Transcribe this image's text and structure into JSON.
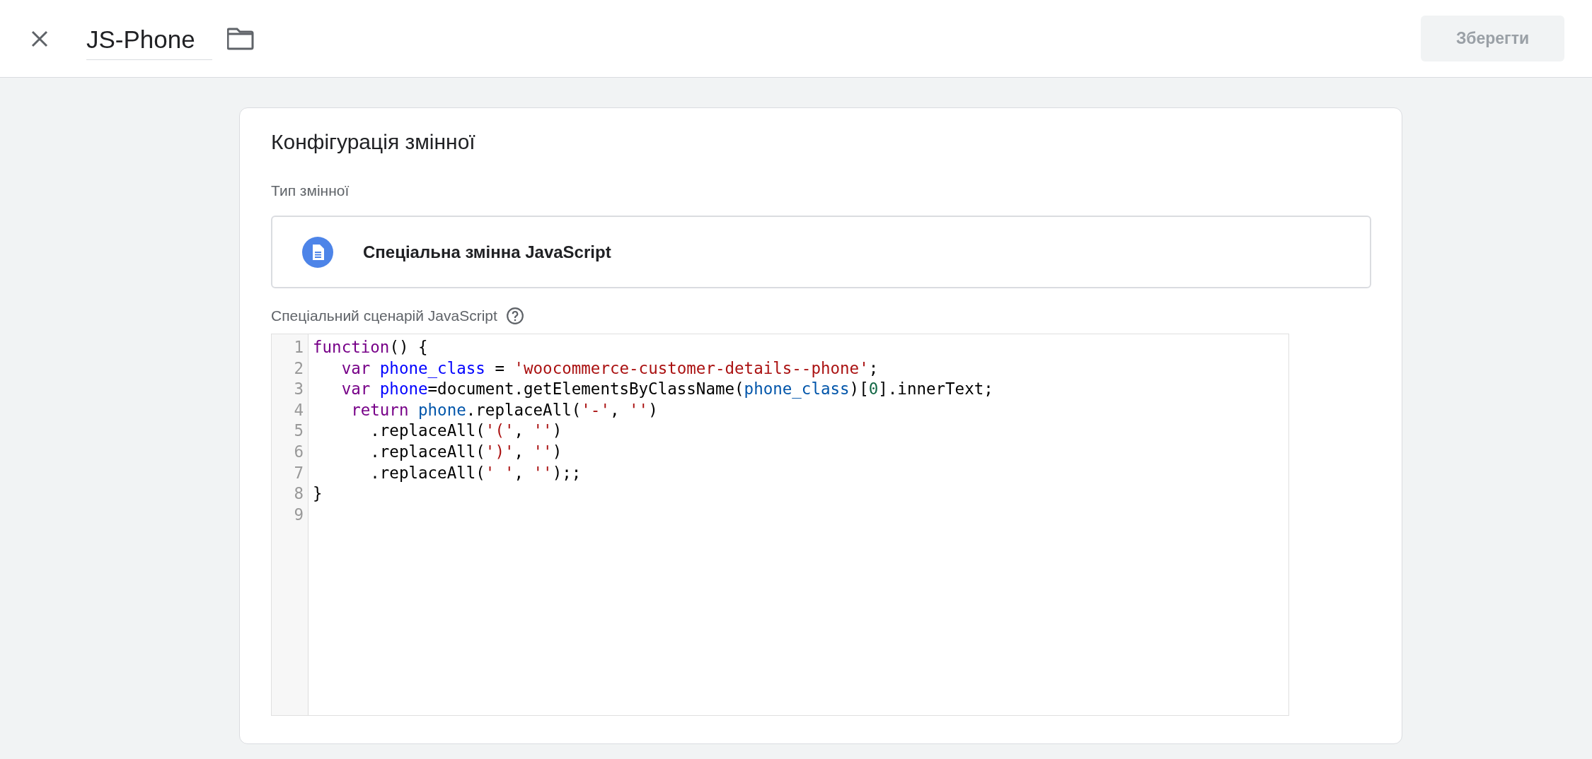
{
  "header": {
    "name": "JS-Phone",
    "save_button": {
      "label": "Зберегти",
      "disabled": true
    }
  },
  "card": {
    "title": "Конфігурація змінної",
    "type_label": "Тип змінної",
    "type_value": "Спеціальна змінна JavaScript",
    "script_label": "Спеціальний сценарій JavaScript",
    "code_lines": [
      {
        "number": "1",
        "tokens": [
          {
            "kind": "keyword",
            "text": "function"
          },
          {
            "kind": "plain",
            "text": "() {"
          }
        ]
      },
      {
        "number": "2",
        "tokens": [
          {
            "kind": "keyword",
            "text": "   var"
          },
          {
            "kind": "def",
            "text": " phone_class"
          },
          {
            "kind": "plain",
            "text": " = "
          },
          {
            "kind": "string",
            "text": "'woocommerce-customer-details--phone'"
          },
          {
            "kind": "plain",
            "text": ";"
          }
        ]
      },
      {
        "number": "3",
        "tokens": [
          {
            "kind": "keyword",
            "text": "   var"
          },
          {
            "kind": "def",
            "text": " phone"
          },
          {
            "kind": "plain",
            "text": "=document.getElementsByClassName("
          },
          {
            "kind": "variable",
            "text": "phone_class"
          },
          {
            "kind": "plain",
            "text": ")["
          },
          {
            "kind": "number",
            "text": "0"
          },
          {
            "kind": "plain",
            "text": "].innerText;"
          }
        ]
      },
      {
        "number": "4",
        "tokens": [
          {
            "kind": "keyword",
            "text": "    return"
          },
          {
            "kind": "variable",
            "text": " phone"
          },
          {
            "kind": "plain",
            "text": ".replaceAll("
          },
          {
            "kind": "string",
            "text": "'-'"
          },
          {
            "kind": "plain",
            "text": ", "
          },
          {
            "kind": "string",
            "text": "''"
          },
          {
            "kind": "plain",
            "text": ")"
          }
        ]
      },
      {
        "number": "5",
        "tokens": [
          {
            "kind": "plain",
            "text": "      .replaceAll("
          },
          {
            "kind": "string",
            "text": "'('"
          },
          {
            "kind": "plain",
            "text": ", "
          },
          {
            "kind": "string",
            "text": "''"
          },
          {
            "kind": "plain",
            "text": ")"
          }
        ]
      },
      {
        "number": "6",
        "tokens": [
          {
            "kind": "plain",
            "text": "      .replaceAll("
          },
          {
            "kind": "string",
            "text": "')'"
          },
          {
            "kind": "plain",
            "text": ", "
          },
          {
            "kind": "string",
            "text": "''"
          },
          {
            "kind": "plain",
            "text": ")"
          }
        ]
      },
      {
        "number": "7",
        "tokens": [
          {
            "kind": "plain",
            "text": "      .replaceAll("
          },
          {
            "kind": "string",
            "text": "' '"
          },
          {
            "kind": "plain",
            "text": ", "
          },
          {
            "kind": "string",
            "text": "''"
          },
          {
            "kind": "plain",
            "text": ");;"
          }
        ]
      },
      {
        "number": "8",
        "tokens": [
          {
            "kind": "plain",
            "text": "}"
          }
        ]
      },
      {
        "number": "9"
      }
    ]
  }
}
